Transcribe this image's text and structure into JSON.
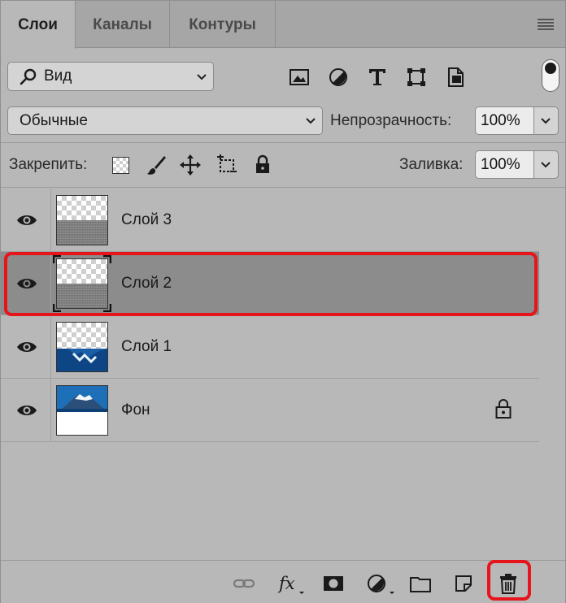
{
  "tabs": [
    {
      "label": "Слои",
      "active": true
    },
    {
      "label": "Каналы",
      "active": false
    },
    {
      "label": "Контуры",
      "active": false
    }
  ],
  "filter": {
    "kind_label": "Вид",
    "icons": [
      "image-filter-icon",
      "adjustment-filter-icon",
      "type-filter-icon",
      "shape-filter-icon",
      "smart-object-filter-icon"
    ]
  },
  "blend": {
    "mode": "Обычные",
    "opacity_label": "Непрозрачность:",
    "opacity_value": "100%"
  },
  "lock": {
    "label": "Закрепить:",
    "fill_label": "Заливка:",
    "fill_value": "100%"
  },
  "layers": [
    {
      "name": "Слой 3",
      "visible": true,
      "selected": false,
      "locked": false,
      "thumb": "noise"
    },
    {
      "name": "Слой 2",
      "visible": true,
      "selected": true,
      "locked": false,
      "thumb": "noise"
    },
    {
      "name": "Слой 1",
      "visible": true,
      "selected": false,
      "locked": false,
      "thumb": "water"
    },
    {
      "name": "Фон",
      "visible": true,
      "selected": false,
      "locked": true,
      "thumb": "mountain"
    }
  ],
  "bottom_icons": [
    "link-icon",
    "fx-icon",
    "mask-icon",
    "adjustment-layer-icon",
    "folder-icon",
    "new-layer-icon",
    "trash-icon"
  ],
  "colors": {
    "highlight": "#e6141b",
    "selected_row": "#8c8c8c",
    "panel": "#b8b8b8"
  }
}
